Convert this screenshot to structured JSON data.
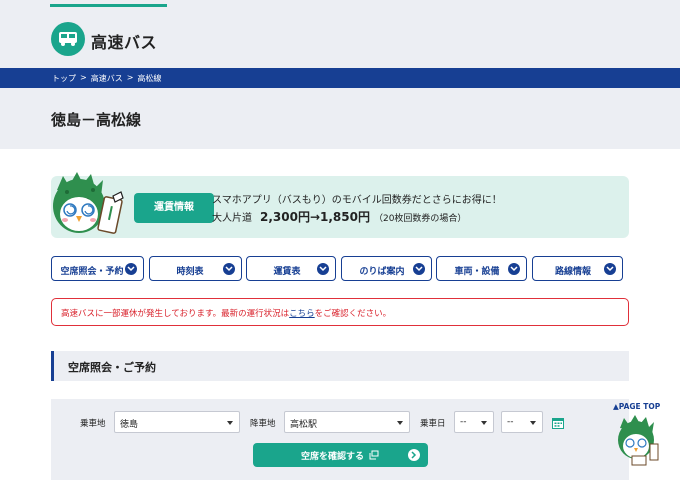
{
  "header": {
    "site_title": "高速バス",
    "logo_icon": "bus-icon",
    "accent_color": "#1aa58c"
  },
  "breadcrumb": {
    "items": [
      "トップ",
      "高速バス",
      "高松線"
    ],
    "separator": ">"
  },
  "page": {
    "title": "徳島－高松線"
  },
  "promo": {
    "button_label": "運賃情報",
    "line1": "スマホアプリ（バスもり）のモバイル回数券だとさらにお得に！",
    "line2_prefix": "大人片道",
    "line2_price": "2,300円→1,850円",
    "line2_note": "（20枚回数券の場合）",
    "mascot_icon": "mascot-icon"
  },
  "nav": {
    "items": [
      {
        "label": "空席照会・予約"
      },
      {
        "label": "時刻表"
      },
      {
        "label": "運賃表"
      },
      {
        "label": "のりば案内"
      },
      {
        "label": "車両・設備"
      },
      {
        "label": "路線情報"
      }
    ]
  },
  "alert": {
    "text_before": "高速バスに一部運休が発生しております。最新の運行状況は",
    "link": "こちら",
    "text_after": "をご確認ください。",
    "color": "#d9232d"
  },
  "section": {
    "title": "空席照会・ご予約"
  },
  "search": {
    "boarding_label": "乗車地",
    "boarding_value": "徳島",
    "alighting_label": "降車地",
    "alighting_value": "高松駅",
    "date_label": "乗車日",
    "date_month": "--",
    "date_day": "--",
    "confirm_label": "空席を確認する"
  },
  "pagetop": {
    "label": "▲PAGE TOP"
  },
  "colors": {
    "navy": "#173f93",
    "teal": "#1aa58c",
    "band": "#eceef3"
  }
}
